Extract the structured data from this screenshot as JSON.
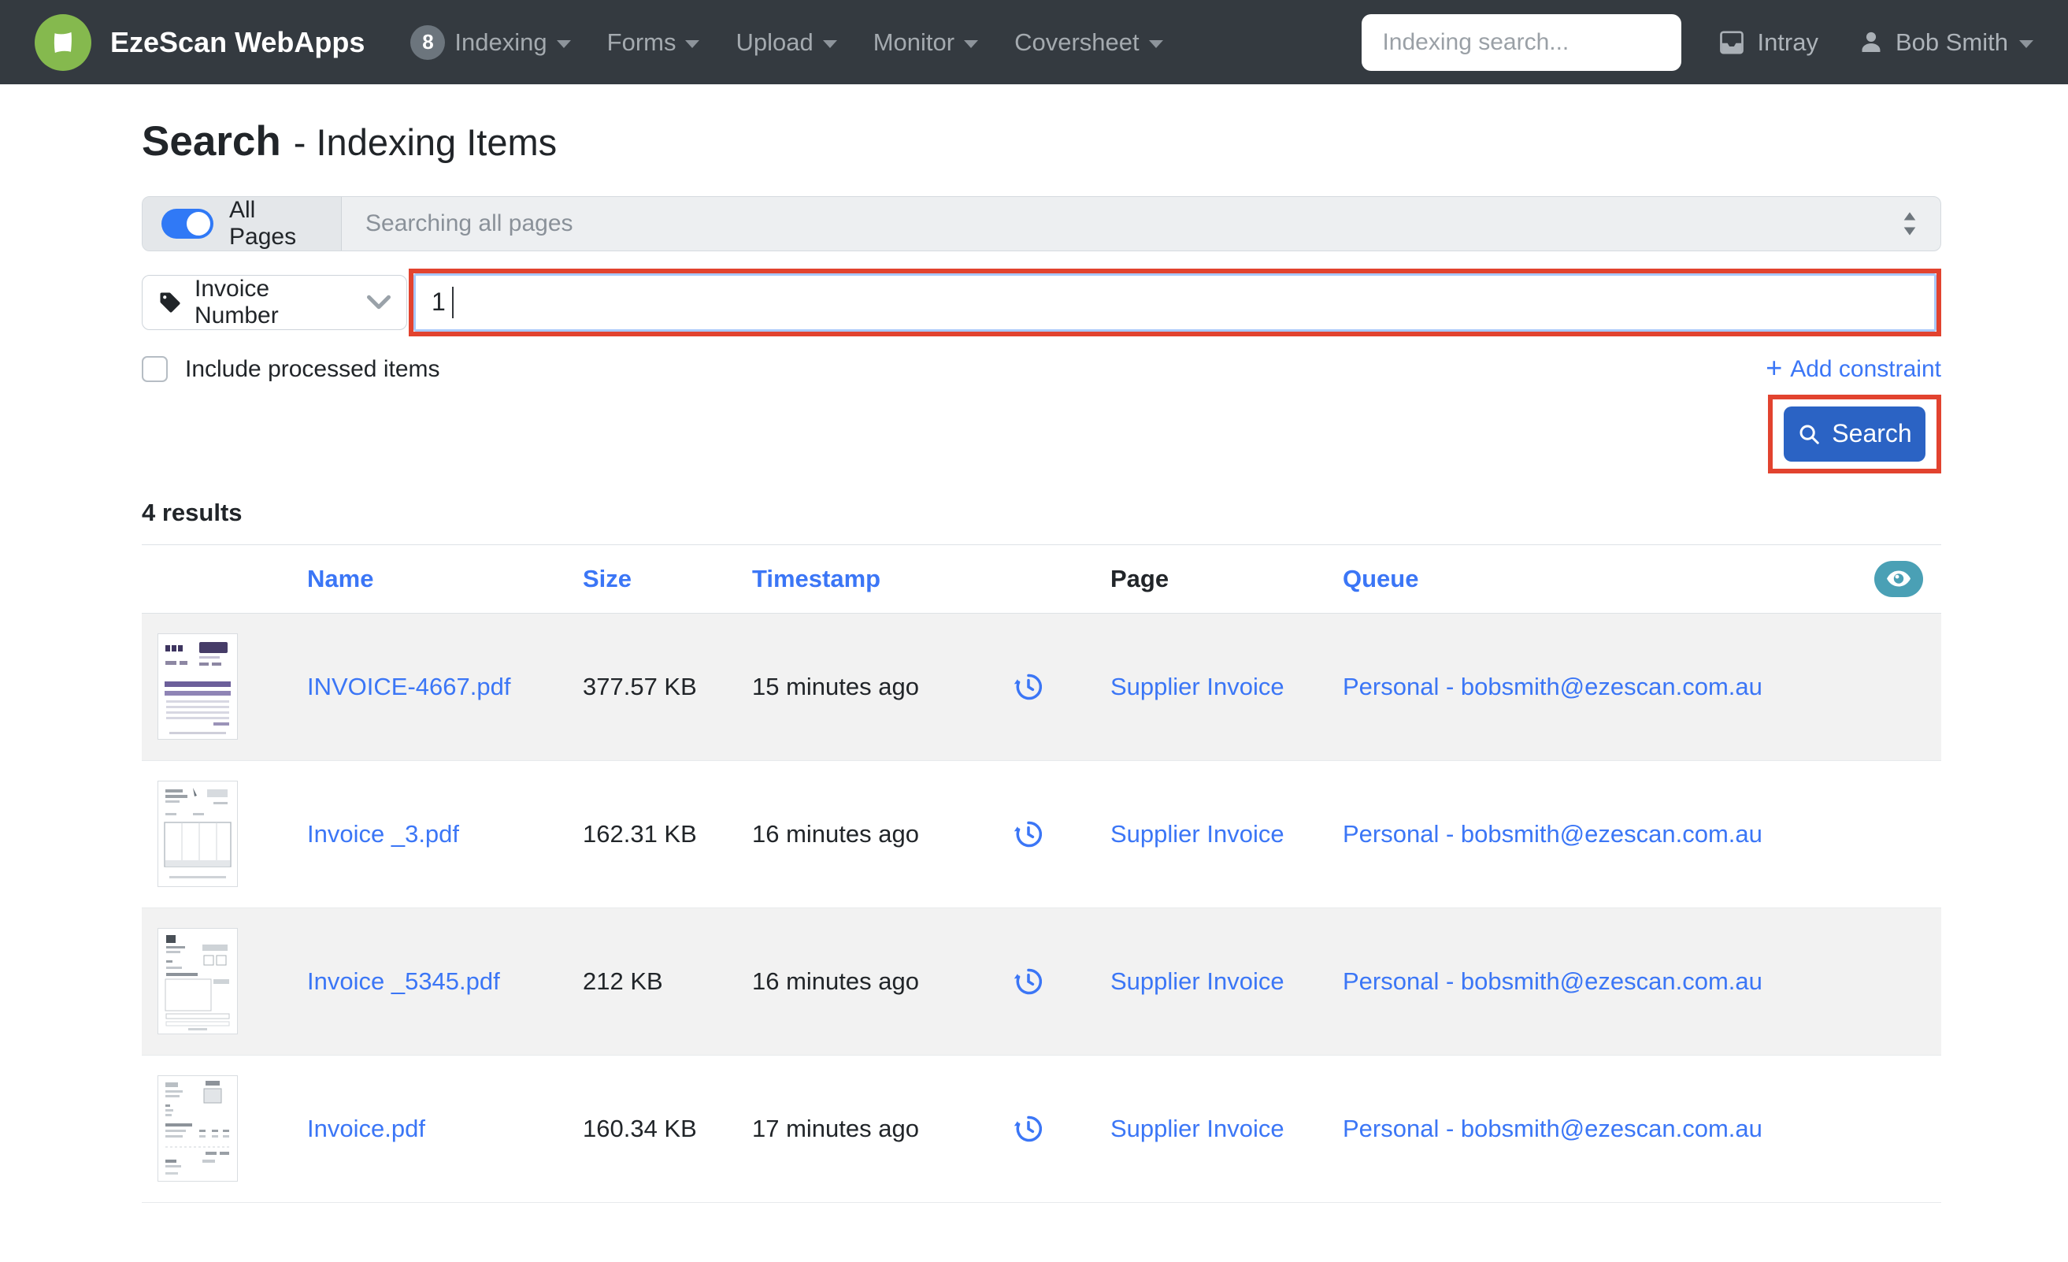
{
  "navbar": {
    "brand": "EzeScan WebApps",
    "badge_count": "8",
    "menus": [
      {
        "label": "Indexing"
      },
      {
        "label": "Forms"
      },
      {
        "label": "Upload"
      },
      {
        "label": "Monitor"
      },
      {
        "label": "Coversheet"
      }
    ],
    "search_placeholder": "Indexing search...",
    "intray_label": "Intray",
    "user_name": "Bob Smith"
  },
  "page": {
    "title_primary": "Search",
    "title_secondary": "- Indexing Items"
  },
  "search_form": {
    "all_pages_label": "All Pages",
    "scope_text": "Searching all pages",
    "field_selector_value": "Invoice Number",
    "query_value": "1",
    "include_processed_label": "Include processed items",
    "add_constraint_plus": "+",
    "add_constraint_label": "Add constraint",
    "search_button_label": "Search"
  },
  "results": {
    "count_text": "4 results",
    "columns": [
      "Name",
      "Size",
      "Timestamp",
      "Page",
      "Queue"
    ],
    "rows": [
      {
        "name": "INVOICE-4667.pdf",
        "size": "377.57 KB",
        "timestamp": "15 minutes ago",
        "page": "Supplier Invoice",
        "queue": "Personal - bobsmith@ezescan.com.au"
      },
      {
        "name": "Invoice _3.pdf",
        "size": "162.31 KB",
        "timestamp": "16 minutes ago",
        "page": "Supplier Invoice",
        "queue": "Personal - bobsmith@ezescan.com.au"
      },
      {
        "name": "Invoice _5345.pdf",
        "size": "212 KB",
        "timestamp": "16 minutes ago",
        "page": "Supplier Invoice",
        "queue": "Personal - bobsmith@ezescan.com.au"
      },
      {
        "name": "Invoice.pdf",
        "size": "160.34 KB",
        "timestamp": "17 minutes ago",
        "page": "Supplier Invoice",
        "queue": "Personal - bobsmith@ezescan.com.au"
      }
    ]
  },
  "icons": {
    "logo": "app-logo",
    "intray": "inbox-tray-icon",
    "user": "person-icon",
    "field": "tag-icon",
    "select": "chevron-down-icon",
    "scope": "sort-arrows-icon",
    "button": "search-icon",
    "row_action": "history-icon",
    "header_action": "eye-icon"
  },
  "colors": {
    "navbar_bg": "#343a40",
    "logo_green": "#85b94e",
    "link_blue": "#3b76f6",
    "button_blue": "#2b63c4",
    "toggle_blue": "#3079f6",
    "eye_teal": "#4aa0b5",
    "annotation_red": "#e2432f",
    "row_stripe": "#f2f2f2"
  }
}
